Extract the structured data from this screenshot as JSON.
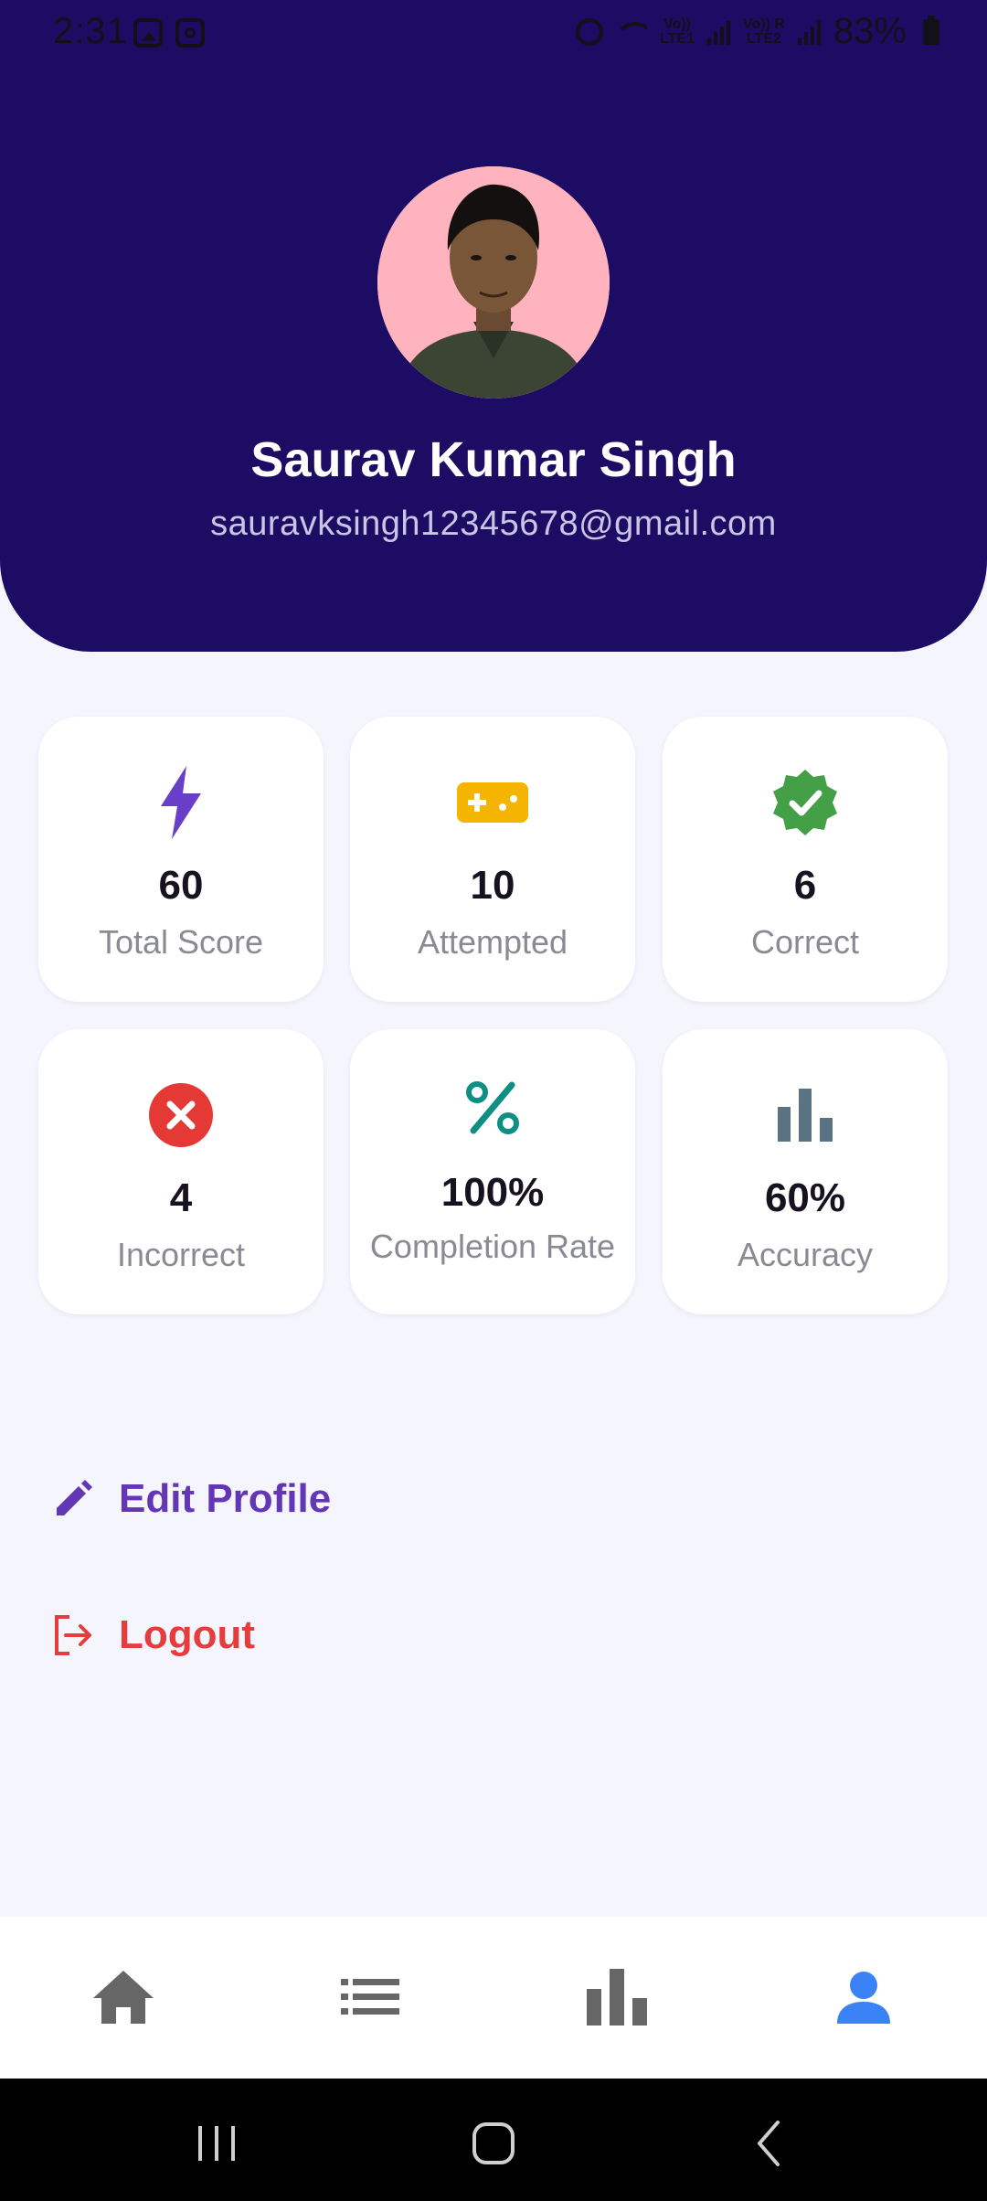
{
  "status_bar": {
    "time": "2:31",
    "volte1_line1": "Vo))",
    "volte1_line2": "LTE1",
    "volte2_line1": "Vo))",
    "volte2_line2": "LTE2",
    "roaming": "R",
    "battery": "83%"
  },
  "profile": {
    "name": "Saurav Kumar Singh",
    "email": "sauravksingh12345678@gmail.com"
  },
  "stats": [
    {
      "value": "60",
      "label": "Total Score",
      "icon": "bolt-icon",
      "color": "#6a3fc7"
    },
    {
      "value": "10",
      "label": "Attempted",
      "icon": "gamepad-icon",
      "color": "#f5b400"
    },
    {
      "value": "6",
      "label": "Correct",
      "icon": "verified-check-icon",
      "color": "#43a047"
    },
    {
      "value": "4",
      "label": "Incorrect",
      "icon": "error-x-icon",
      "color": "#e53935"
    },
    {
      "value": "100%",
      "label": "Completion Rate",
      "icon": "percent-icon",
      "color": "#0e8f83"
    },
    {
      "value": "60%",
      "label": "Accuracy",
      "icon": "bar-chart-icon",
      "color": "#5a7382"
    }
  ],
  "actions": {
    "edit_label": "Edit Profile",
    "logout_label": "Logout"
  },
  "bottom_nav": {
    "active": "profile",
    "active_color": "#3b82f6",
    "inactive_color": "#666666"
  }
}
